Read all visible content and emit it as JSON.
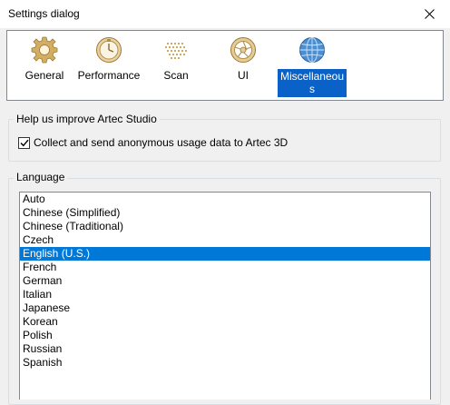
{
  "window": {
    "title": "Settings dialog"
  },
  "toolbar": {
    "items": [
      {
        "label": "General",
        "icon": "gear-icon"
      },
      {
        "label": "Performance",
        "icon": "stopwatch-icon"
      },
      {
        "label": "Scan",
        "icon": "dot-grid-icon"
      },
      {
        "label": "UI",
        "icon": "aperture-icon"
      },
      {
        "label": "Miscellaneous",
        "icon": "globe-icon",
        "selected": true
      }
    ]
  },
  "improve_group": {
    "title": "Help us improve Artec Studio",
    "checkbox_label": "Collect and send anonymous usage data to Artec 3D",
    "checked": true
  },
  "language_group": {
    "title": "Language",
    "selected": "English (U.S.)",
    "items": [
      "Auto",
      "Chinese (Simplified)",
      "Chinese (Traditional)",
      "Czech",
      "English (U.S.)",
      "French",
      "German",
      "Italian",
      "Japanese",
      "Korean",
      "Polish",
      "Russian",
      "Spanish"
    ]
  },
  "colors": {
    "selection": "#0078d7",
    "icon_gold": "#c9a254"
  }
}
